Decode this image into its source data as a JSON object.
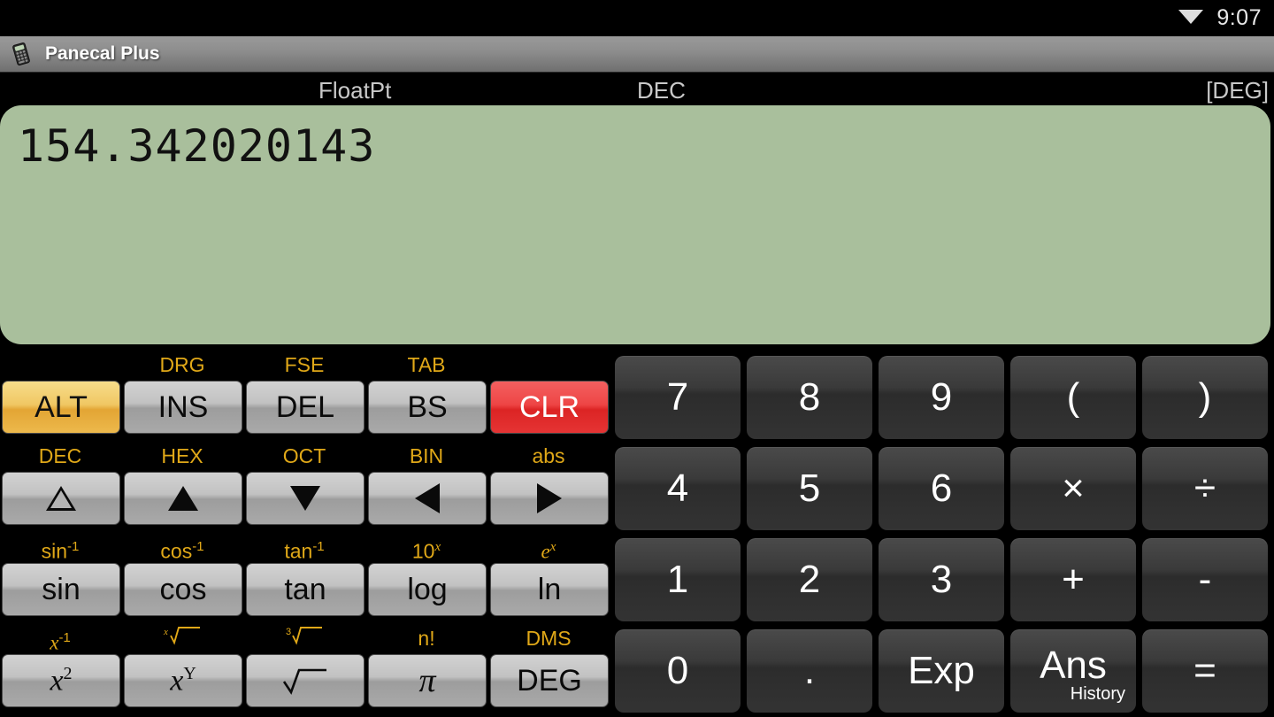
{
  "statusbar": {
    "wifi_icon": "wifi-icon",
    "time": "9:07"
  },
  "titlebar": {
    "icon": "calculator-app-icon",
    "title": "Panecal Plus"
  },
  "display_header": {
    "notation": "FloatPt",
    "base": "DEC",
    "angle": "[DEG]"
  },
  "display": {
    "value": "154.342020143"
  },
  "colors": {
    "display_bg": "#a9bf9c",
    "alt_label": "#e0a818",
    "alt_key": "#e3a534",
    "clear_key": "#dc2424",
    "gray_key": "#c2c2c2",
    "num_key": "#3a3a3a",
    "titlebar": "#8c8c8c"
  },
  "function_pad": {
    "rows": [
      {
        "keys": [
          {
            "alt": "",
            "label": "ALT",
            "name": "alt-key",
            "style": "gold"
          },
          {
            "alt": "DRG",
            "label": "INS",
            "name": "ins-key",
            "style": "gray"
          },
          {
            "alt": "FSE",
            "label": "DEL",
            "name": "del-key",
            "style": "gray"
          },
          {
            "alt": "TAB",
            "label": "BS",
            "name": "bs-key",
            "style": "gray"
          },
          {
            "alt": "",
            "label": "CLR",
            "name": "clr-key",
            "style": "red"
          }
        ]
      },
      {
        "keys": [
          {
            "alt": "DEC",
            "label": "",
            "name": "cursor-up-hollow-key",
            "style": "gray"
          },
          {
            "alt": "HEX",
            "label": "",
            "name": "cursor-up-key",
            "style": "gray"
          },
          {
            "alt": "OCT",
            "label": "",
            "name": "cursor-down-key",
            "style": "gray"
          },
          {
            "alt": "BIN",
            "label": "",
            "name": "cursor-left-key",
            "style": "gray"
          },
          {
            "alt": "abs",
            "label": "",
            "name": "cursor-right-key",
            "style": "gray"
          }
        ]
      },
      {
        "keys": [
          {
            "alt": "sin-1",
            "label": "sin",
            "name": "sin-key",
            "style": "gray"
          },
          {
            "alt": "cos-1",
            "label": "cos",
            "name": "cos-key",
            "style": "gray"
          },
          {
            "alt": "tan-1",
            "label": "tan",
            "name": "tan-key",
            "style": "gray"
          },
          {
            "alt": "10^x",
            "label": "log",
            "name": "log-key",
            "style": "gray"
          },
          {
            "alt": "e^x",
            "label": "ln",
            "name": "ln-key",
            "style": "gray"
          }
        ]
      },
      {
        "keys": [
          {
            "alt": "x-1",
            "label": "x2",
            "name": "square-key",
            "style": "gray"
          },
          {
            "alt": "xroot",
            "label": "xY",
            "name": "power-key",
            "style": "gray"
          },
          {
            "alt": "cbrt",
            "label": "sqrt",
            "name": "sqrt-key",
            "style": "gray"
          },
          {
            "alt": "n!",
            "label": "pi",
            "name": "pi-key",
            "style": "gray"
          },
          {
            "alt": "DMS",
            "label": "DEG",
            "name": "deg-key",
            "style": "gray"
          }
        ]
      }
    ],
    "alt_labels": {
      "r1": [
        "",
        "DRG",
        "FSE",
        "TAB",
        ""
      ],
      "r2": [
        "DEC",
        "HEX",
        "OCT",
        "BIN",
        "abs"
      ],
      "r3_base": [
        "sin",
        "cos",
        "tan",
        "10",
        "e"
      ],
      "r3_sup": [
        "-1",
        "-1",
        "-1",
        "x",
        "x"
      ],
      "r4": [
        "x",
        "",
        "",
        "n!",
        "DMS"
      ]
    }
  },
  "numeric_pad": {
    "rows": [
      [
        {
          "label": "7",
          "name": "key-7"
        },
        {
          "label": "8",
          "name": "key-8"
        },
        {
          "label": "9",
          "name": "key-9"
        },
        {
          "label": "(",
          "name": "key-open-paren"
        },
        {
          "label": ")",
          "name": "key-close-paren"
        }
      ],
      [
        {
          "label": "4",
          "name": "key-4"
        },
        {
          "label": "5",
          "name": "key-5"
        },
        {
          "label": "6",
          "name": "key-6"
        },
        {
          "label": "×",
          "name": "key-multiply"
        },
        {
          "label": "÷",
          "name": "key-divide"
        }
      ],
      [
        {
          "label": "1",
          "name": "key-1"
        },
        {
          "label": "2",
          "name": "key-2"
        },
        {
          "label": "3",
          "name": "key-3"
        },
        {
          "label": "+",
          "name": "key-plus"
        },
        {
          "label": "-",
          "name": "key-minus"
        }
      ],
      [
        {
          "label": "0",
          "name": "key-0"
        },
        {
          "label": ".",
          "name": "key-decimal-point"
        },
        {
          "label": "Exp",
          "name": "key-exp"
        },
        {
          "label": "Ans",
          "sub": "History",
          "name": "key-ans"
        },
        {
          "label": "=",
          "name": "key-equals"
        }
      ]
    ]
  }
}
